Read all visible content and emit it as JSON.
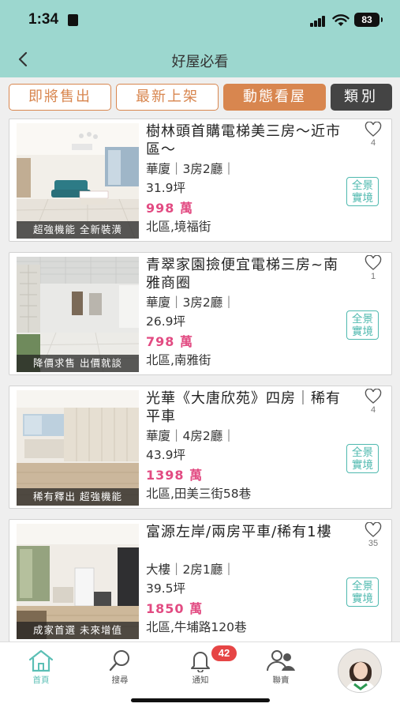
{
  "status": {
    "time": "1:34",
    "battery": "83"
  },
  "header": {
    "title": "好屋必看"
  },
  "tabs": [
    {
      "label": "即將售出"
    },
    {
      "label": "最新上架"
    },
    {
      "label": "動態看屋"
    },
    {
      "label": "類別"
    }
  ],
  "listings": [
    {
      "title": "樹林頭首購電梯美三房～近市區～",
      "spec": "華廈｜3房2廳｜",
      "area": "31.9坪",
      "price": "998 萬",
      "address": "北區,境福街",
      "likes": "4",
      "tags": "超強機能 全新裝潢",
      "vr": "全景實境"
    },
    {
      "title": "青翠家園撿便宜電梯三房~南雅商圈",
      "spec": "華廈｜3房2廳｜",
      "area": "26.9坪",
      "price": "798 萬",
      "address": "北區,南雅街",
      "likes": "1",
      "tags": "降價求售 出價就談",
      "vr": "全景實境"
    },
    {
      "title": "光華《大唐欣苑》四房｜稀有平車",
      "spec": "華廈｜4房2廳｜",
      "area": "43.9坪",
      "price": "1398 萬",
      "address": "北區,田美三街58巷",
      "likes": "4",
      "tags": "稀有釋出 超強機能",
      "vr": "全景實境"
    },
    {
      "title": "富源左岸/兩房平車/稀有1樓",
      "spec": "大樓｜2房1廳｜",
      "area": "39.5坪",
      "price": "1850 萬",
      "address": "北區,牛埔路120巷",
      "likes": "35",
      "tags": "成家首選 未來增值",
      "vr": "全景實境"
    }
  ],
  "bottom_nav": {
    "home": "首頁",
    "search": "搜尋",
    "notify": "通知",
    "notify_badge": "42",
    "contact": "聯賣"
  },
  "colors": {
    "accent": "#9cd7cf",
    "tab_orange": "#d8864f",
    "price_pink": "#e24b82",
    "vr_teal": "#4fb9af"
  }
}
